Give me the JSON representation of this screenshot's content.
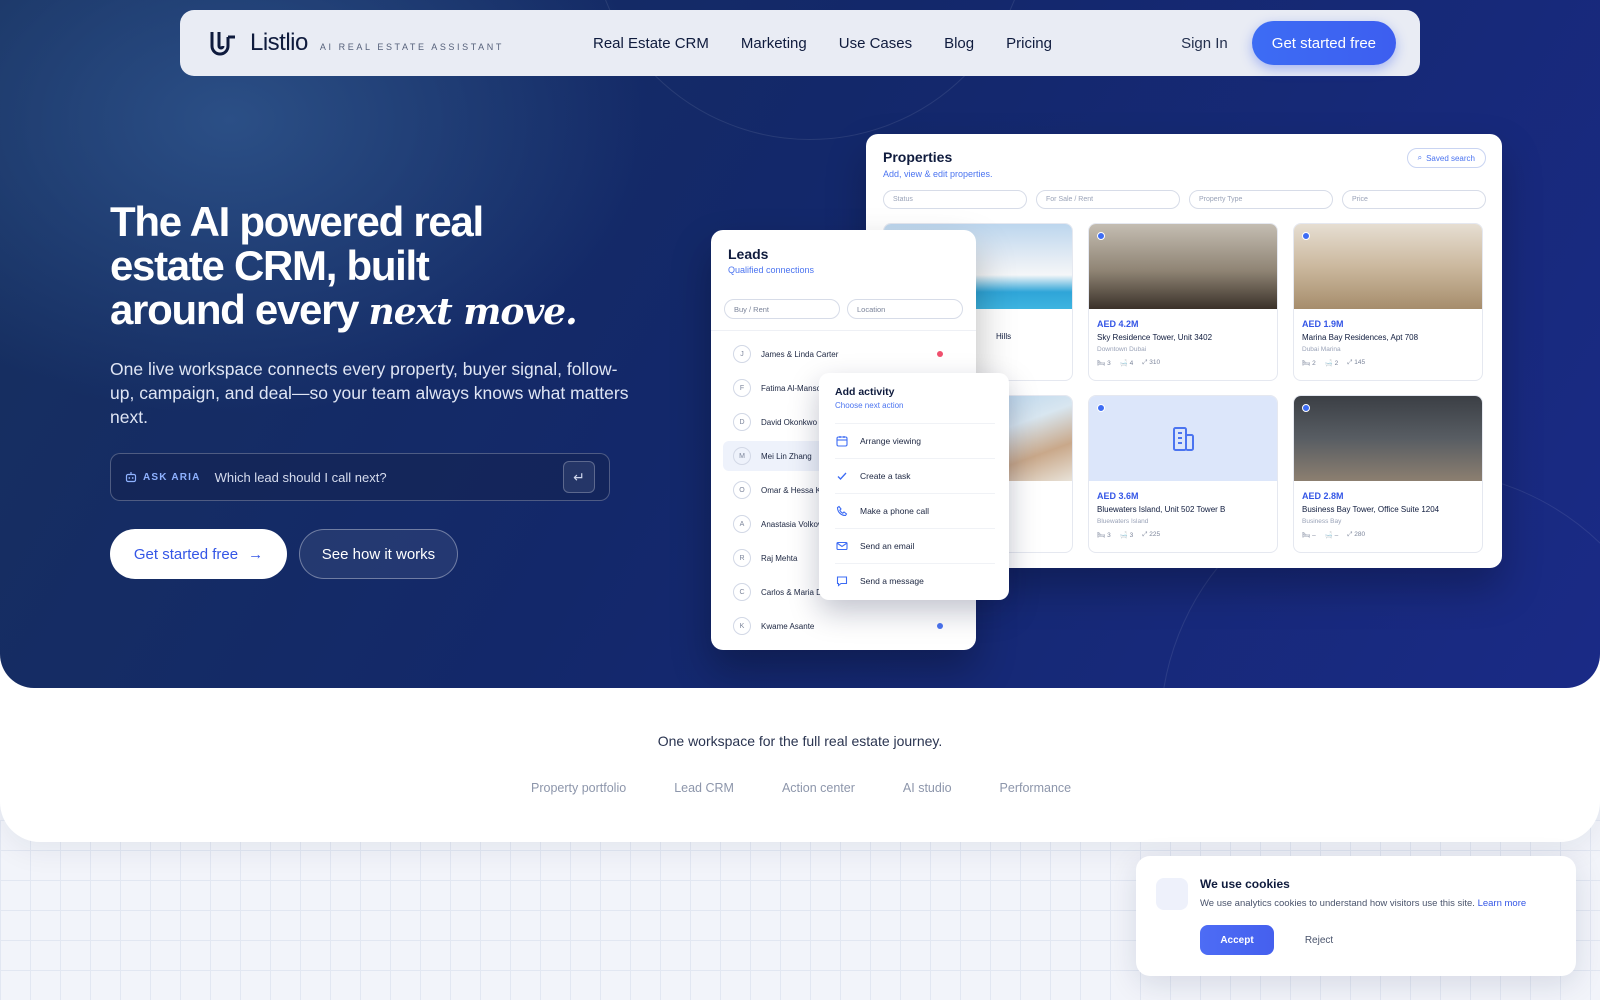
{
  "nav": {
    "brand": "Listlio",
    "tagline": "AI REAL ESTATE ASSISTANT",
    "links": [
      "Real Estate CRM",
      "Marketing",
      "Use Cases",
      "Blog",
      "Pricing"
    ],
    "sign_in": "Sign In",
    "cta": "Get started free"
  },
  "hero": {
    "title_line1": "The AI powered real",
    "title_line2": "estate CRM, built",
    "title_line3a": "around every ",
    "title_line3b": "next move.",
    "subtitle": "One live workspace connects every property, buyer signal, follow-up, campaign, and deal—so your team always knows what matters next.",
    "ask_label": "ASK ARIA",
    "ask_prompt": "Which lead should I call next?",
    "cta_primary": "Get started free",
    "cta_secondary": "See how it works"
  },
  "properties": {
    "title": "Properties",
    "subtitle": "Add, view & edit properties.",
    "saved_search": "Saved search",
    "filters": [
      "Status",
      "For Sale / Rent",
      "Property Type",
      "Price"
    ],
    "partial_name": "Hills",
    "cards": [
      {
        "price": "AED 4.2M",
        "name": "Sky Residence Tower, Unit 3402",
        "location": "Downtown Dubai",
        "beds": "3",
        "baths": "4",
        "area": "310"
      },
      {
        "price": "AED 1.9M",
        "name": "Marina Bay Residences, Apt 708",
        "location": "Dubai Marina",
        "beds": "2",
        "baths": "2",
        "area": "145"
      },
      {
        "price": "AED 3.6M",
        "name": "Bluewaters Island, Unit 502 Tower B",
        "location": "Bluewaters Island",
        "beds": "3",
        "baths": "3",
        "area": "225"
      },
      {
        "price": "AED 2.8M",
        "name": "Business Bay Tower, Office Suite 1204",
        "location": "Business Bay",
        "beds": "–",
        "baths": "–",
        "area": "280"
      }
    ]
  },
  "leads": {
    "title": "Leads",
    "subtitle": "Qualified connections",
    "filter_buy": "Buy / Rent",
    "filter_location": "Location",
    "rows": [
      {
        "initial": "J",
        "name": "James & Linda Carter",
        "status": "#f0506e"
      },
      {
        "initial": "F",
        "name": "Fatima Al-Mansoori",
        "status": ""
      },
      {
        "initial": "D",
        "name": "David Okonkwo",
        "status": ""
      },
      {
        "initial": "M",
        "name": "Mei Lin Zhang",
        "status": ""
      },
      {
        "initial": "O",
        "name": "Omar & Hessa K.",
        "status": ""
      },
      {
        "initial": "A",
        "name": "Anastasia Volkova",
        "status": ""
      },
      {
        "initial": "R",
        "name": "Raj Mehta",
        "status": ""
      },
      {
        "initial": "C",
        "name": "Carlos & Maria D.",
        "status": ""
      },
      {
        "initial": "K",
        "name": "Kwame Asante",
        "status": "#4b74f0"
      }
    ]
  },
  "activity": {
    "title": "Add activity",
    "subtitle": "Choose next action",
    "items": [
      {
        "icon": "calendar-icon",
        "label": "Arrange viewing"
      },
      {
        "icon": "check-icon",
        "label": "Create a task"
      },
      {
        "icon": "phone-icon",
        "label": "Make a phone call"
      },
      {
        "icon": "mail-icon",
        "label": "Send an email"
      },
      {
        "icon": "message-icon",
        "label": "Send a message"
      }
    ]
  },
  "journey": {
    "heading": "One workspace for the full real estate journey.",
    "tabs": [
      "Property portfolio",
      "Lead CRM",
      "Action center",
      "AI studio",
      "Performance"
    ]
  },
  "cookie": {
    "title": "We use cookies",
    "text": "We use analytics cookies to understand how visitors use this site.",
    "learn_more": "Learn more",
    "accept": "Accept",
    "reject": "Reject"
  },
  "colors": {
    "accent": "#3d6cf4",
    "hero_bg": "#17305e",
    "alert": "#f0506e"
  }
}
